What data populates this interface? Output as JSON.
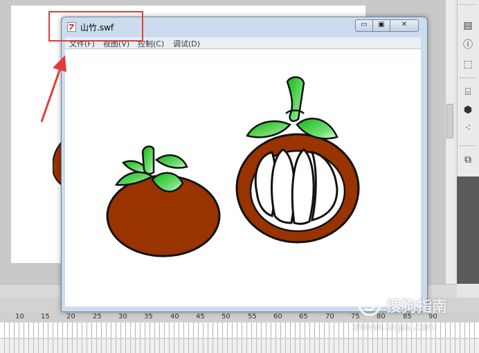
{
  "window": {
    "title": "山竹.swf",
    "minimize_label": "▭",
    "maximize_label": "▣",
    "close_label": "✕"
  },
  "menu": {
    "items": [
      {
        "label": "文件(F)"
      },
      {
        "label": "视图(V)"
      },
      {
        "label": "控制(C)"
      },
      {
        "label": "调试(D)"
      }
    ]
  },
  "timeline": {
    "ruler_labels": [
      "10",
      "15",
      "20",
      "25",
      "30",
      "35",
      "40",
      "45",
      "50",
      "55",
      "60",
      "65",
      "70",
      "75",
      "80",
      "85",
      "90"
    ]
  },
  "watermark": {
    "brand": "搜狗指南",
    "url": "zhinan.sogou.com"
  },
  "colors": {
    "highlight": "#e23b3b",
    "fruit_body": "#993300",
    "leaf_green": "#22c322",
    "outline": "#111111"
  },
  "icons": {
    "title_icon": "flash-file-icon",
    "watermark_icon": "sogou-logo-icon"
  }
}
